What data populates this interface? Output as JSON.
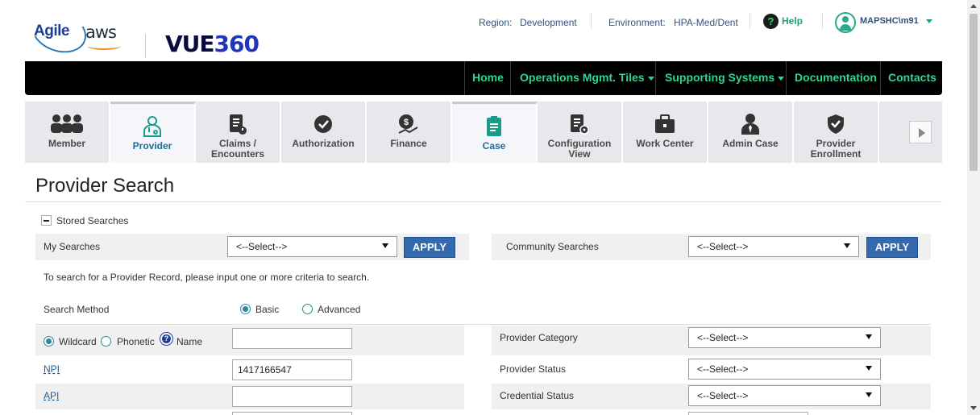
{
  "brand": {
    "agile": "Agile",
    "aws": "aws",
    "vue": "VUE",
    "vue_num": "360"
  },
  "header": {
    "region_label": "Region:",
    "region_value": "Development",
    "env_label": "Environment:",
    "env_value": "HPA-Med/Dent",
    "help": "Help",
    "user": "MAPSHC\\m91"
  },
  "nav": {
    "home": "Home",
    "operations": "Operations Mgmt. Tiles",
    "supporting": "Supporting Systems",
    "documentation": "Documentation",
    "contacts": "Contacts"
  },
  "tiles": [
    {
      "label": "Member",
      "icon": "users-icon"
    },
    {
      "label": "Provider",
      "icon": "doctor-icon"
    },
    {
      "label": "Claims / Encounters",
      "icon": "claims-icon"
    },
    {
      "label": "Authorization",
      "icon": "check-circle-icon"
    },
    {
      "label": "Finance",
      "icon": "finance-icon"
    },
    {
      "label": "Case",
      "icon": "clipboard-icon"
    },
    {
      "label": "Configuration View",
      "icon": "config-doc-icon"
    },
    {
      "label": "Work Center",
      "icon": "briefcase-icon"
    },
    {
      "label": "Admin Case",
      "icon": "admin-icon"
    },
    {
      "label": "Provider Enrollment",
      "icon": "shield-check-icon"
    }
  ],
  "page": {
    "title": "Provider Search"
  },
  "stored": {
    "label": "Stored Searches",
    "my_searches": "My Searches",
    "community_searches": "Community Searches",
    "select_placeholder": "<--Select-->",
    "apply": "APPLY"
  },
  "form": {
    "instructions": "To search for a Provider Record, please input one or more criteria to search.",
    "search_method": "Search Method",
    "basic": "Basic",
    "advanced": "Advanced",
    "wildcard": "Wildcard",
    "phonetic": "Phonetic",
    "name": "Name",
    "npi": "NPI",
    "npi_value": "1417166547",
    "api": "API",
    "provider_category": "Provider Category",
    "provider_status": "Provider Status",
    "credential_status": "Credential Status",
    "select_placeholder": "<--Select-->"
  },
  "colors": {
    "nav_bg": "#000000",
    "nav_text": "#2ed68e",
    "accent": "#3469ae"
  }
}
